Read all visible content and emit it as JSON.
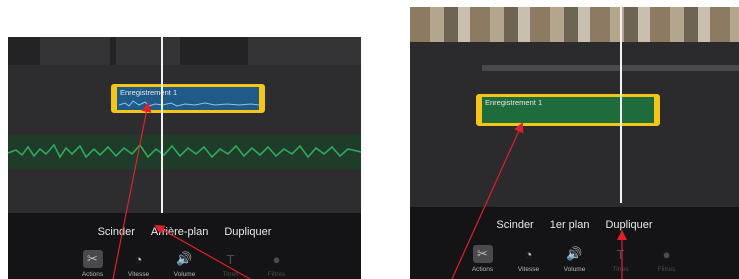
{
  "left_screen": {
    "clip": {
      "name": "Enregistrement 1"
    },
    "toolbar_options": [
      "Scinder",
      "Arrière-plan",
      "Dupliquer"
    ],
    "tabs": [
      {
        "label": "Actions",
        "icon": "scissors-icon",
        "selected": true
      },
      {
        "label": "Vitesse",
        "icon": "speedometer-icon",
        "selected": false
      },
      {
        "label": "Volume",
        "icon": "speaker-icon",
        "selected": false
      },
      {
        "label": "Titres",
        "icon": "title-t-icon",
        "selected": false
      },
      {
        "label": "Filtres",
        "icon": "filters-icon",
        "selected": false
      }
    ]
  },
  "right_screen": {
    "clip": {
      "name": "Enregistrement 1"
    },
    "toolbar_options": [
      "Scinder",
      "1er plan",
      "Dupliquer"
    ],
    "tabs": [
      {
        "label": "Actions",
        "icon": "scissors-icon",
        "selected": true
      },
      {
        "label": "Vitesse",
        "icon": "speedometer-icon",
        "selected": false
      },
      {
        "label": "Volume",
        "icon": "speaker-icon",
        "selected": false
      },
      {
        "label": "Titres",
        "icon": "title-t-icon",
        "selected": false
      },
      {
        "label": "Filtres",
        "icon": "filters-icon",
        "selected": false
      }
    ]
  },
  "colors": {
    "clip_border": "#f5c518",
    "annotation_arrow": "#e0202a",
    "left_clip_fill": "#1f5a88",
    "right_clip_fill": "#1e6b3b",
    "audio_waveform": "#2fa95a"
  }
}
